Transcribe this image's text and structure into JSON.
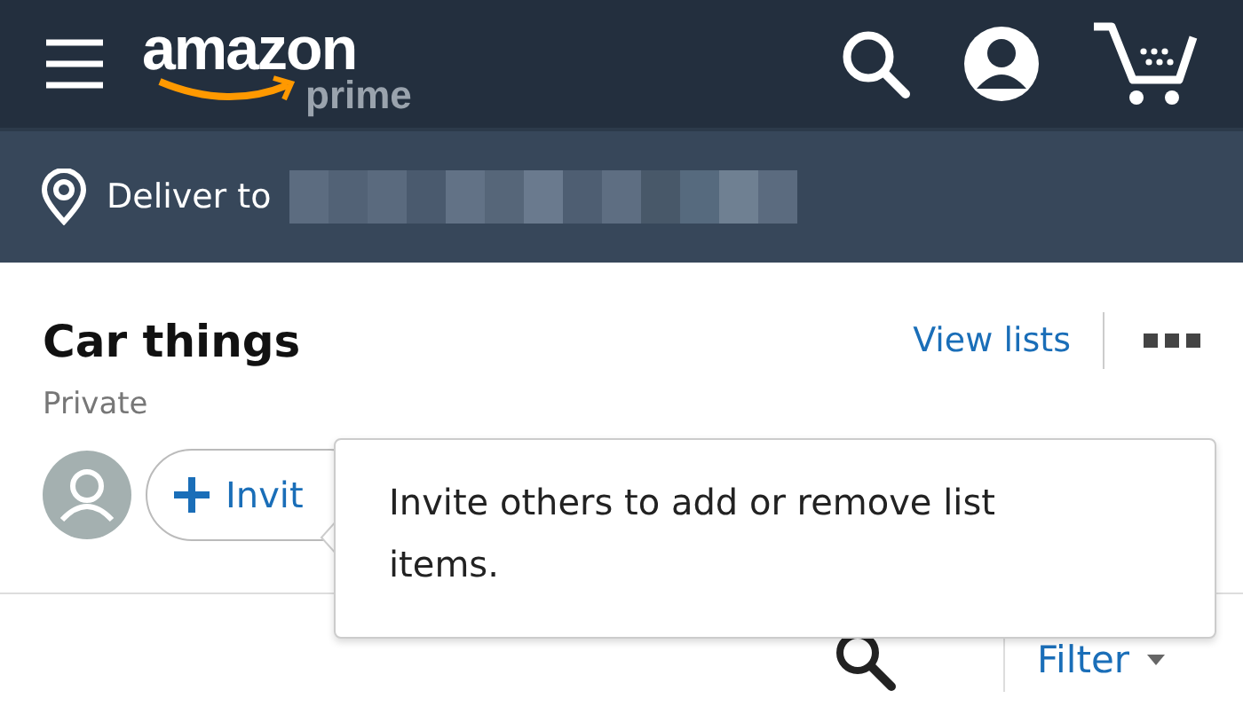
{
  "header": {
    "logo": {
      "wordmark": "amazon",
      "tier": "prime"
    }
  },
  "delivery_bar": {
    "label": "Deliver to"
  },
  "list": {
    "title": "Car things",
    "privacy": "Private",
    "view_lists": "View lists",
    "invite_button": "Invit"
  },
  "tooltip": {
    "text": "Invite others to add or remove list items."
  },
  "toolbar": {
    "filter": "Filter"
  }
}
